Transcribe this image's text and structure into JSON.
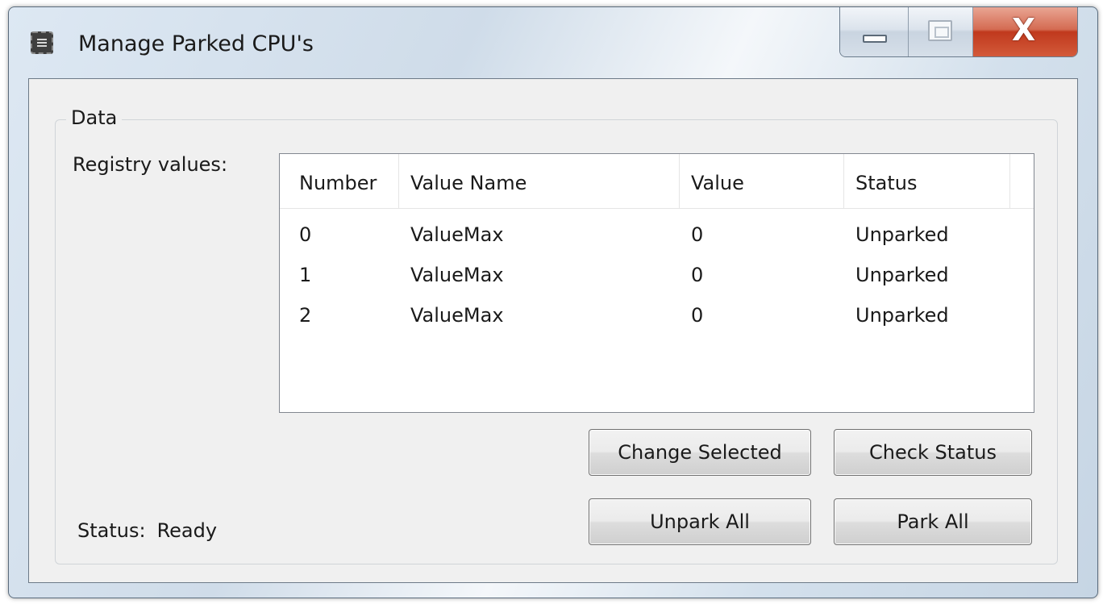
{
  "window": {
    "title": "Manage Parked CPU's",
    "close_glyph": "X",
    "icon": "app-form-icon"
  },
  "groupbox": {
    "legend": "Data"
  },
  "registry": {
    "label": "Registry values:",
    "columns": [
      "Number",
      "Value Name",
      "Value",
      "Status"
    ],
    "rows": [
      {
        "number": "0",
        "value_name": "ValueMax",
        "value": "0",
        "status": "Unparked"
      },
      {
        "number": "1",
        "value_name": "ValueMax",
        "value": "0",
        "status": "Unparked"
      },
      {
        "number": "2",
        "value_name": "ValueMax",
        "value": "0",
        "status": "Unparked"
      }
    ]
  },
  "buttons": {
    "change_selected": "Change Selected",
    "check_status": "Check Status",
    "unpark_all": "Unpark All",
    "park_all": "Park All"
  },
  "status": {
    "label": "Status:",
    "value": "Ready"
  }
}
